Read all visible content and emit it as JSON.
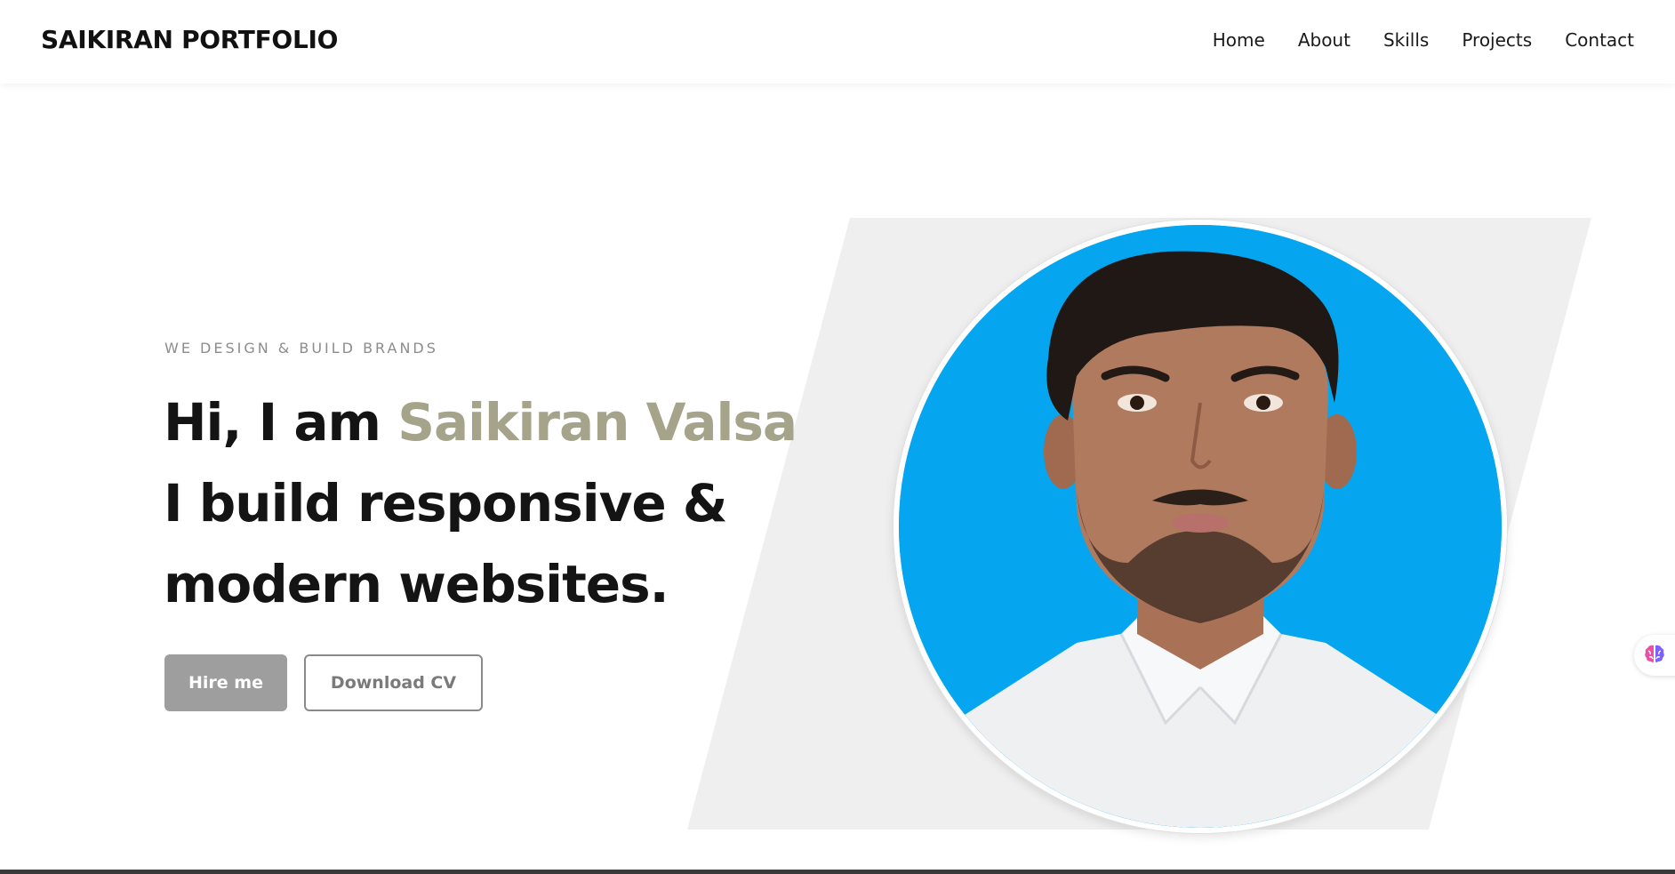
{
  "navbar": {
    "brand": "SAIKIRAN PORTFOLIO",
    "links": [
      "Home",
      "About",
      "Skills",
      "Projects",
      "Contact"
    ]
  },
  "hero": {
    "eyebrow": "WE DESIGN & BUILD BRANDS",
    "greeting": "Hi, I am ",
    "name": "Saikiran Valsa",
    "line2": "I build responsive &",
    "line3": "modern websites.",
    "hire_button": "Hire me",
    "cv_button": "Download CV"
  },
  "colors": {
    "accent_name": "#a5a48a",
    "hire_button_bg": "#9e9e9e",
    "photo_bg": "#05a6ef",
    "shape_bg": "#efefef"
  },
  "icons": {
    "side_widget": "brain-icon"
  }
}
